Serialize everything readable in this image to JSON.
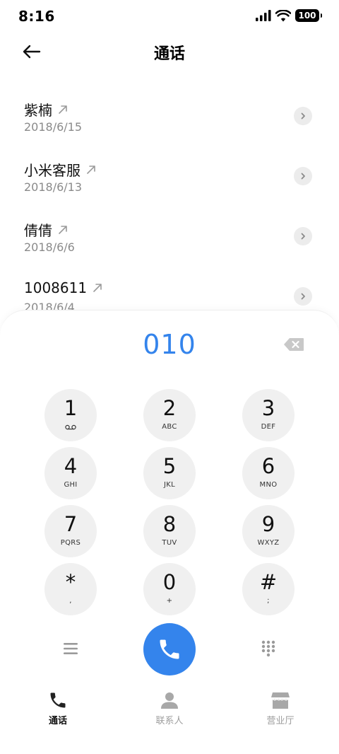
{
  "status_bar": {
    "time": "8:16",
    "battery": "100"
  },
  "header": {
    "title": "通话"
  },
  "calls": [
    {
      "name": "紫楠",
      "date": "2018/6/15"
    },
    {
      "name": "小米客服",
      "date": "2018/6/13"
    },
    {
      "name": "倩倩",
      "date": "2018/6/6"
    },
    {
      "name": "1008611",
      "date": "2018/6/4"
    }
  ],
  "dialer": {
    "number": "010",
    "keys": [
      {
        "digit": "1",
        "letters": ""
      },
      {
        "digit": "2",
        "letters": "ABC"
      },
      {
        "digit": "3",
        "letters": "DEF"
      },
      {
        "digit": "4",
        "letters": "GHI"
      },
      {
        "digit": "5",
        "letters": "JKL"
      },
      {
        "digit": "6",
        "letters": "MNO"
      },
      {
        "digit": "7",
        "letters": "PQRS"
      },
      {
        "digit": "8",
        "letters": "TUV"
      },
      {
        "digit": "9",
        "letters": "WXYZ"
      },
      {
        "digit": "*",
        "letters": ","
      },
      {
        "digit": "0",
        "letters": "+"
      },
      {
        "digit": "#",
        "letters": ";"
      }
    ]
  },
  "nav": {
    "items": [
      {
        "label": "通话"
      },
      {
        "label": "联系人"
      },
      {
        "label": "营业厅"
      }
    ]
  },
  "colors": {
    "accent": "#3484ec",
    "key_background": "#f0f0f0",
    "muted_text": "#8a8a8a",
    "nav_inactive": "#9e9e9e"
  }
}
